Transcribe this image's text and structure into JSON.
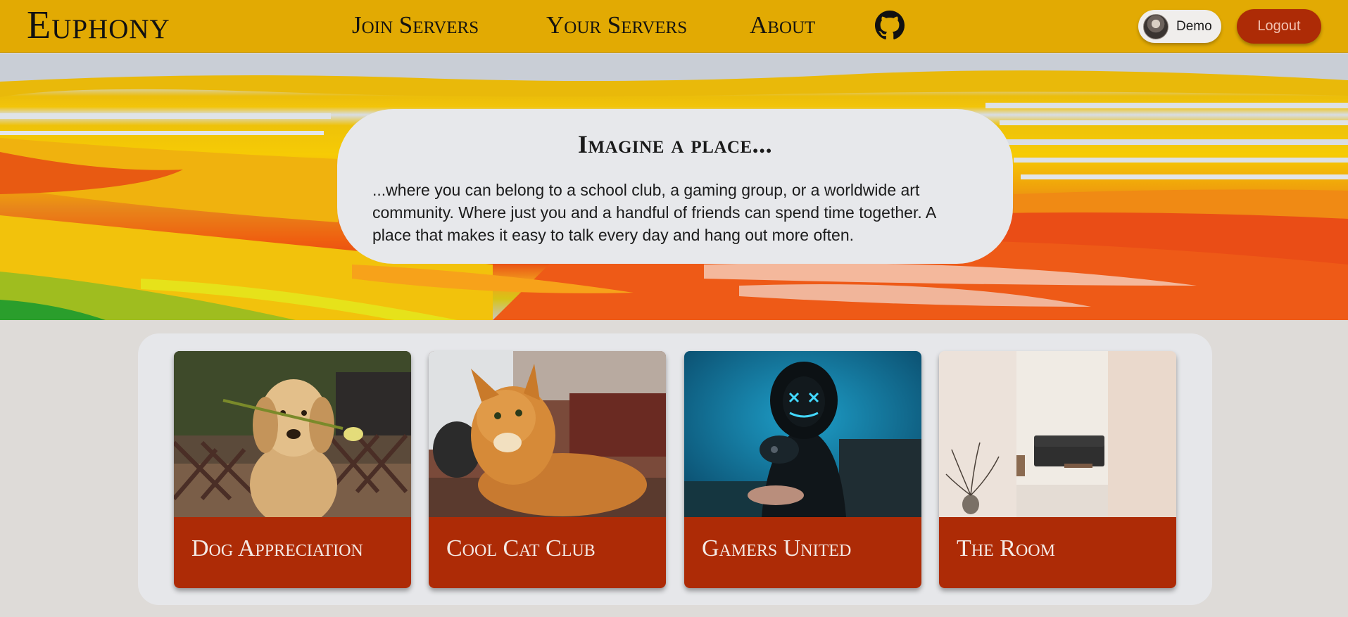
{
  "navbar": {
    "brand": "Euphony",
    "links": [
      {
        "label": "Join Servers"
      },
      {
        "label": "Your Servers"
      },
      {
        "label": "About"
      }
    ],
    "github_icon": "github-icon",
    "user": {
      "name": "Demo"
    },
    "logout_label": "Logout",
    "bar_color": "#e2aa03",
    "accent_color": "#ad2b06"
  },
  "hero": {
    "title": "Imagine a place...",
    "text": "...where you can belong to a school club, a gaming group, or a worldwide art community. Where just you and a handful of friends can spend time together. A place that makes it easy to talk every day and hang out more often."
  },
  "servers": [
    {
      "name": "Dog Appreciation"
    },
    {
      "name": "Cool Cat Club"
    },
    {
      "name": "Gamers United"
    },
    {
      "name": "The Room"
    }
  ]
}
